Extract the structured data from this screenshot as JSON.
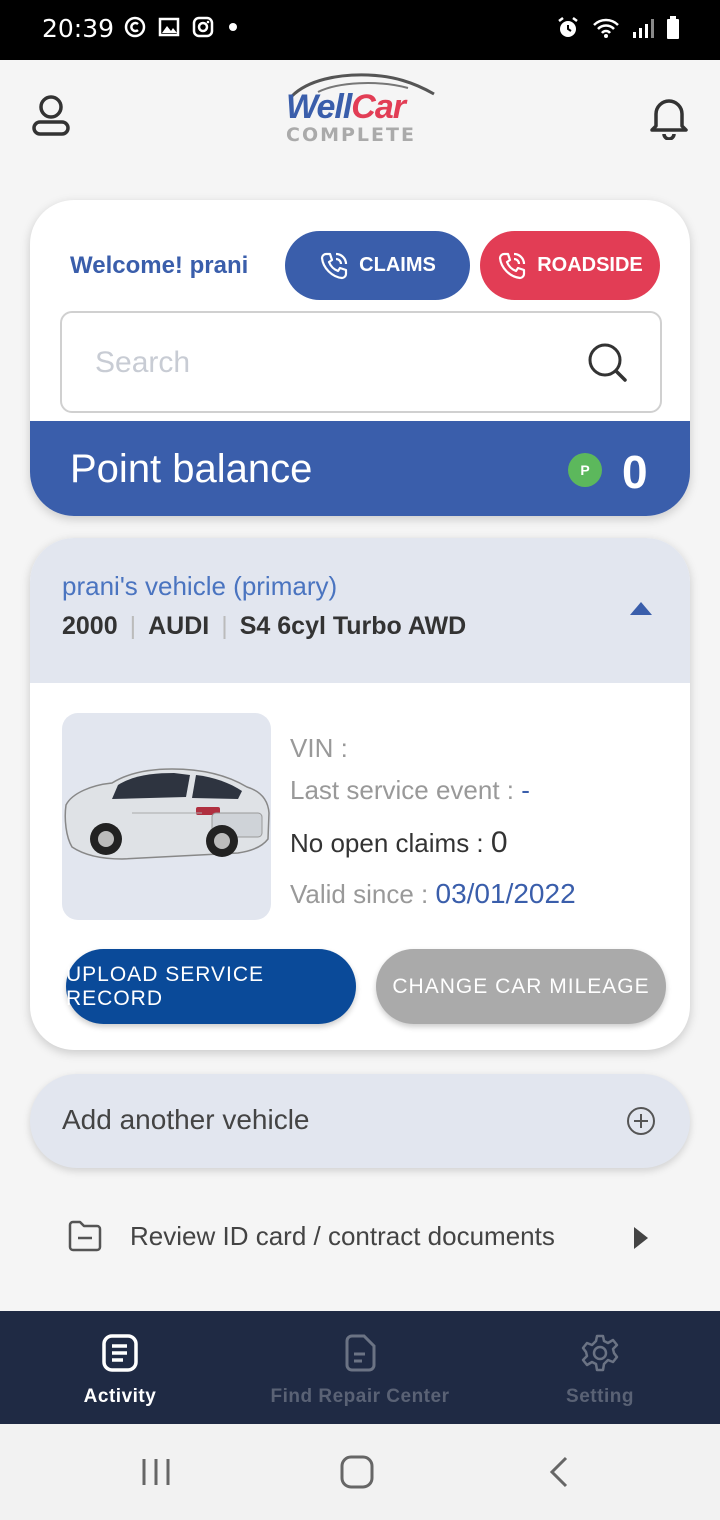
{
  "status_bar": {
    "time": "20:39"
  },
  "app": {
    "logo_line1a": "Well",
    "logo_line1b": "Car",
    "logo_line2": "COMPLETE"
  },
  "welcome_card": {
    "welcome_text": "Welcome! prani",
    "claims_label": "CLAIMS",
    "roadside_label": "ROADSIDE",
    "search_placeholder": "Search",
    "point_balance_label": "Point balance",
    "point_badge": "P",
    "point_balance_value": "0"
  },
  "vehicle": {
    "title": "prani's vehicle (primary)",
    "year": "2000",
    "make": "AUDI",
    "model": "S4 6cyl Turbo AWD",
    "vin_label": "VIN :",
    "last_service_label": "Last service event :",
    "last_service_value": "-",
    "open_claims_label": "No open claims :",
    "open_claims_value": "0",
    "valid_since_label": "Valid since :",
    "valid_since_value": "03/01/2022",
    "upload_button": "UPLOAD SERVICE RECORD",
    "mileage_button": "CHANGE CAR MILEAGE"
  },
  "add_vehicle_label": "Add another vehicle",
  "review_documents_label": "Review ID card / contract documents",
  "bottom_nav": [
    {
      "label": "Activity",
      "active": true
    },
    {
      "label": "Find Repair Center",
      "active": false
    },
    {
      "label": "Setting",
      "active": false
    }
  ],
  "colors": {
    "primary": "#3a5eab",
    "roadside": "#e23d55",
    "upload_button": "#0a4a99",
    "nav_background": "#1f2a44"
  }
}
